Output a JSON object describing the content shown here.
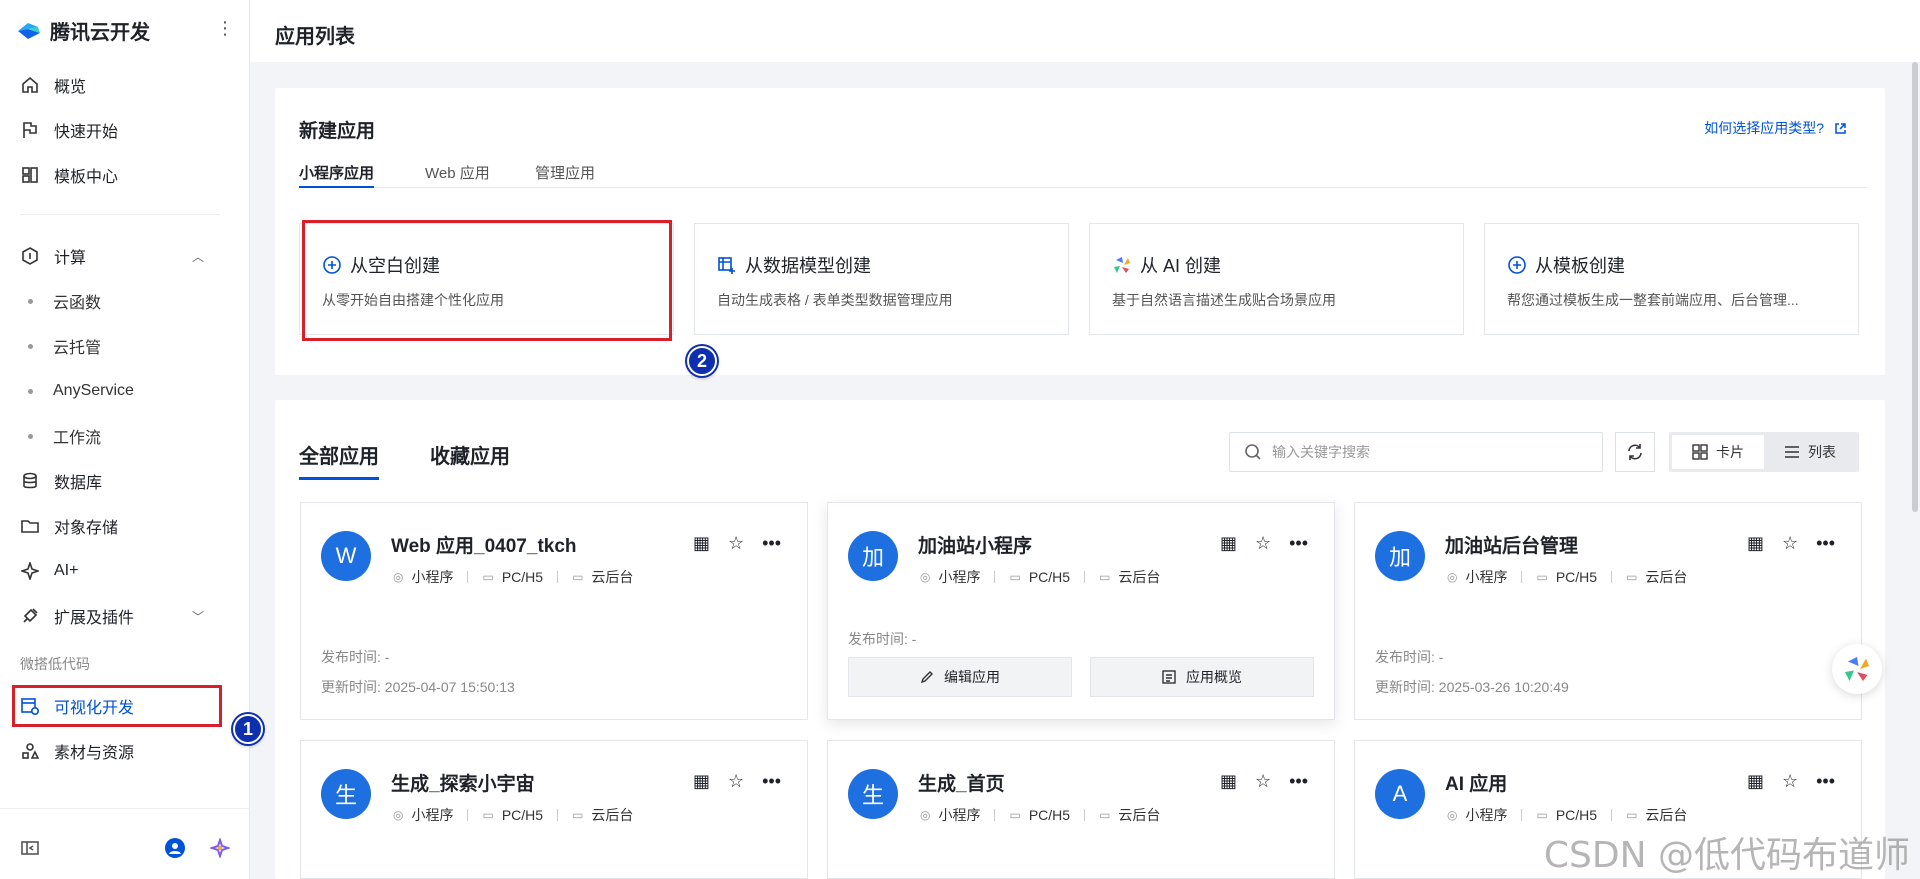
{
  "brand": {
    "name": "腾讯云开发",
    "more": "⋮"
  },
  "nav": {
    "overview": "概览",
    "quick_start": "快速开始",
    "template_center": "模板中心",
    "compute": "计算",
    "compute_items": [
      "云函数",
      "云托管",
      "AnyService",
      "工作流"
    ],
    "database": "数据库",
    "object_storage": "对象存储",
    "ai_plus": "AI+",
    "extensions": "扩展及插件",
    "section_lowcode": "微搭低代码",
    "visual_dev": "可视化开发",
    "assets": "素材与资源"
  },
  "header": {
    "title": "应用列表"
  },
  "new_app": {
    "title": "新建应用",
    "help_link": "如何选择应用类型?",
    "tabs": [
      "小程序应用",
      "Web 应用",
      "管理应用"
    ],
    "options": [
      {
        "title": "从空白创建",
        "desc": "从零开始自由搭建个性化应用"
      },
      {
        "title": "从数据模型创建",
        "desc": "自动生成表格 / 表单类型数据管理应用"
      },
      {
        "title": "从 AI 创建",
        "desc": "基于自然语言描述生成贴合场景应用"
      },
      {
        "title": "从模板创建",
        "desc": "帮您通过模板生成一整套前端应用、后台管理..."
      }
    ]
  },
  "apps_section": {
    "tabs": [
      "全部应用",
      "收藏应用"
    ],
    "search_placeholder": "输入关键字搜索",
    "view_card": "卡片",
    "view_list": "列表",
    "labels": {
      "publish": "发布时间:",
      "update": "更新时间:",
      "tag_mini": "小程序",
      "tag_pc": "PC/H5",
      "tag_cloud": "云后台",
      "edit": "编辑应用",
      "overview": "应用概览"
    },
    "apps": [
      {
        "avatar": "W",
        "name": "Web 应用_0407_tkch",
        "publish": "-",
        "update": "2025-04-07 15:50:13"
      },
      {
        "avatar": "加",
        "name": "加油站小程序",
        "publish": "-",
        "update": ""
      },
      {
        "avatar": "加",
        "name": "加油站后台管理",
        "publish": "-",
        "update": "2025-03-26 10:20:49"
      },
      {
        "avatar": "生",
        "name": "生成_探索小宇宙"
      },
      {
        "avatar": "生",
        "name": "生成_首页"
      },
      {
        "avatar": "A",
        "name": "AI 应用"
      }
    ]
  },
  "badges": {
    "step1": "1",
    "step2": "2"
  },
  "watermark": "CSDN @低代码布道师",
  "colors": {
    "primary": "#0052d9",
    "highlight": "#d8202a",
    "badge": "#0e2fae"
  }
}
